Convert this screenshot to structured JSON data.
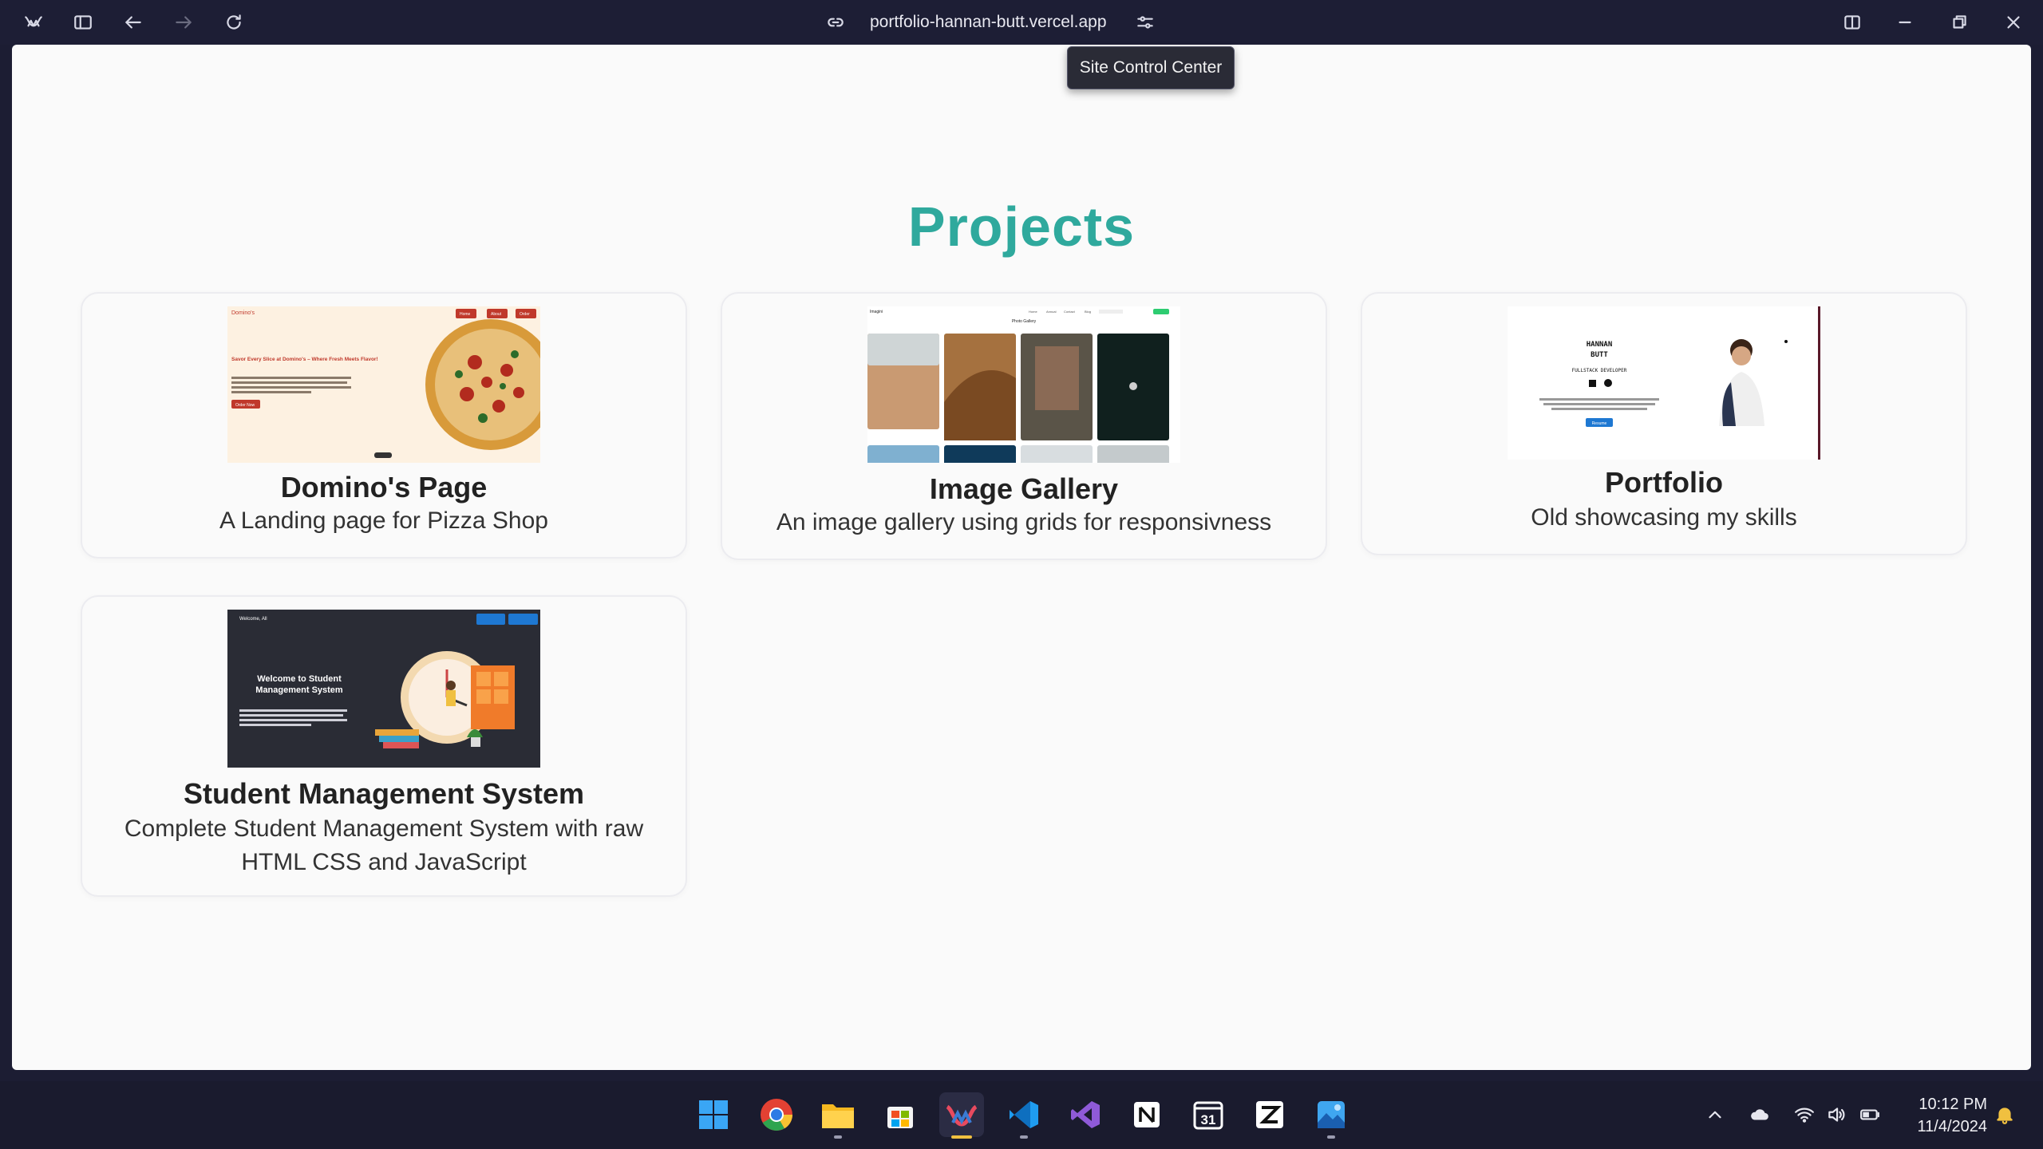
{
  "browser": {
    "url": "portfolio-hannan-butt.vercel.app",
    "tooltip": "Site Control Center"
  },
  "page": {
    "title": "Projects",
    "projects": [
      {
        "title": "Domino's Page",
        "description": "A Landing page for Pizza Shop",
        "thumb": {
          "brand": "Domino's",
          "nav": [
            "Home",
            "About",
            "Order"
          ],
          "headline": "Savor Every Slice at Domino's – Where Fresh Meets Flavor!",
          "cta": "Order Now"
        }
      },
      {
        "title": "Image Gallery",
        "description": "An image gallery using grids for responsivness",
        "thumb": {
          "brand": "Imagini",
          "heading": "Photo Gallery",
          "nav": [
            "Home",
            "Annual",
            "Contact",
            "Blog"
          ]
        }
      },
      {
        "title": "Portfolio",
        "description": "Old showcasing my skills",
        "thumb": {
          "name_line1": "HANNAN",
          "name_line2": "BUTT",
          "role": "FULLSTACK DEVELOPER",
          "button": "Resume"
        }
      },
      {
        "title": "Student Management System",
        "description": "Complete Student Management System with raw HTML CSS and JavaScript",
        "thumb": {
          "greeting": "Welcome, All",
          "headline": "Welcome to Student Management System"
        }
      }
    ]
  },
  "taskbar": {
    "apps": [
      "start-icon",
      "chrome-icon",
      "file-explorer-icon",
      "store-icon",
      "browser-icon",
      "vscode-icon",
      "visual-studio-icon",
      "notion-icon",
      "calendar-icon",
      "zed-icon",
      "photos-icon"
    ],
    "calendar_day": "31",
    "time": "10:12 PM",
    "date": "11/4/2024"
  },
  "colors": {
    "accent": "#2fa99d",
    "chrome_bg": "#1d1e35",
    "page_bg": "#fafafa"
  }
}
